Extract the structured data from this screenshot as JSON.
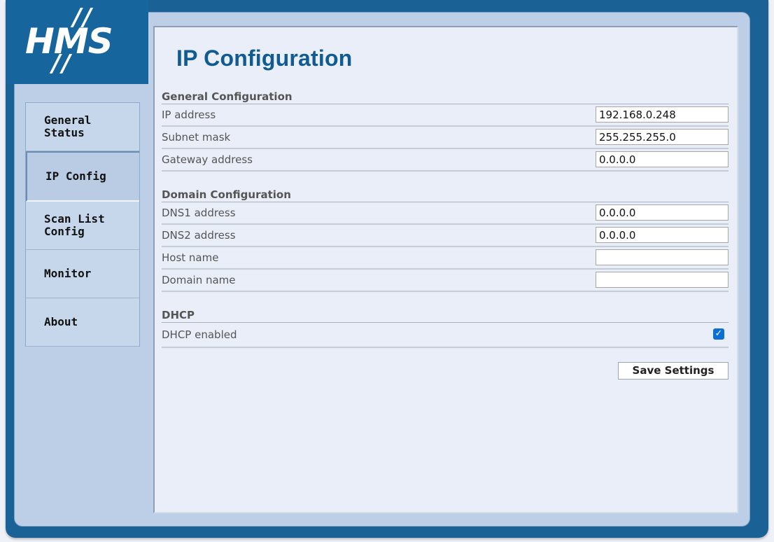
{
  "brand": {
    "logo_text": "HMS",
    "logo_slashes": "//"
  },
  "nav": {
    "items": [
      {
        "label": "General Status"
      },
      {
        "label": "IP Config"
      },
      {
        "label": "Scan List Config"
      },
      {
        "label": "Monitor"
      },
      {
        "label": "About"
      }
    ],
    "active_index": 1
  },
  "page": {
    "title": "IP Configuration"
  },
  "general": {
    "title": "General Configuration",
    "ip_label": "IP address",
    "ip_value": "192.168.0.248",
    "subnet_label": "Subnet mask",
    "subnet_value": "255.255.255.0",
    "gateway_label": "Gateway address",
    "gateway_value": "0.0.0.0"
  },
  "domain": {
    "title": "Domain Configuration",
    "dns1_label": "DNS1 address",
    "dns1_value": "0.0.0.0",
    "dns2_label": "DNS2 address",
    "dns2_value": "0.0.0.0",
    "host_label": "Host name",
    "host_value": "",
    "domain_label": "Domain name",
    "domain_value": ""
  },
  "dhcp": {
    "title": "DHCP",
    "enabled_label": "DHCP enabled",
    "enabled": true,
    "check_glyph": "✓"
  },
  "actions": {
    "save_label": "Save Settings"
  },
  "colors": {
    "brand_blue": "#1a6296",
    "title_blue": "#105c92",
    "checkbox_blue": "#0b6fd6"
  }
}
